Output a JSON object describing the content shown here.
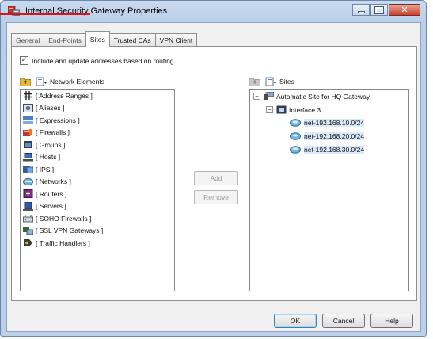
{
  "window": {
    "title": "Internal Security Gateway Properties"
  },
  "tabs": [
    {
      "label": "General"
    },
    {
      "label": "End-Points"
    },
    {
      "label": "Sites",
      "active": true
    },
    {
      "label": "Trusted CAs"
    },
    {
      "label": "VPN Client"
    }
  ],
  "sites_tab": {
    "include_checkbox": {
      "label": "Include and update addresses based on routing",
      "checked": true
    },
    "left_pane": {
      "header": "Network Elements",
      "items": [
        {
          "label": "[ Address Ranges ]",
          "icon": "address-ranges-icon"
        },
        {
          "label": "[ Aliases ]",
          "icon": "aliases-icon"
        },
        {
          "label": "[ Expressions ]",
          "icon": "expressions-icon"
        },
        {
          "label": "[ Firewalls ]",
          "icon": "firewalls-icon"
        },
        {
          "label": "[ Groups ]",
          "icon": "groups-icon"
        },
        {
          "label": "[ Hosts ]",
          "icon": "hosts-icon"
        },
        {
          "label": "[ IPS ]",
          "icon": "ips-icon"
        },
        {
          "label": "[ Networks ]",
          "icon": "networks-icon"
        },
        {
          "label": "[ Routers ]",
          "icon": "routers-icon"
        },
        {
          "label": "[ Servers ]",
          "icon": "servers-icon"
        },
        {
          "label": "[ SOHO Firewalls ]",
          "icon": "soho-firewalls-icon"
        },
        {
          "label": "[ SSL VPN Gateways ]",
          "icon": "ssl-vpn-gateways-icon"
        },
        {
          "label": "[ Traffic Handlers ]",
          "icon": "traffic-handlers-icon"
        }
      ]
    },
    "middle_buttons": {
      "add": "Add",
      "remove": "Remove"
    },
    "right_pane": {
      "header": "Sites",
      "site": {
        "label": "Automatic Site for HQ Gateway",
        "expanded": true
      },
      "interface": {
        "label": "Interface 3",
        "expanded": true
      },
      "networks": [
        {
          "label": "net-192.168.10.0/24"
        },
        {
          "label": "net-192.168.20.0/24"
        },
        {
          "label": "net-192.168.30.0/24"
        }
      ]
    }
  },
  "footer_buttons": {
    "ok": "OK",
    "cancel": "Cancel",
    "help": "Help"
  },
  "colors": {
    "title_bar": "#bcd1e9",
    "close_button": "#c8442d",
    "annotation_line": "#d8141a",
    "selection": "#dbe9f8"
  }
}
